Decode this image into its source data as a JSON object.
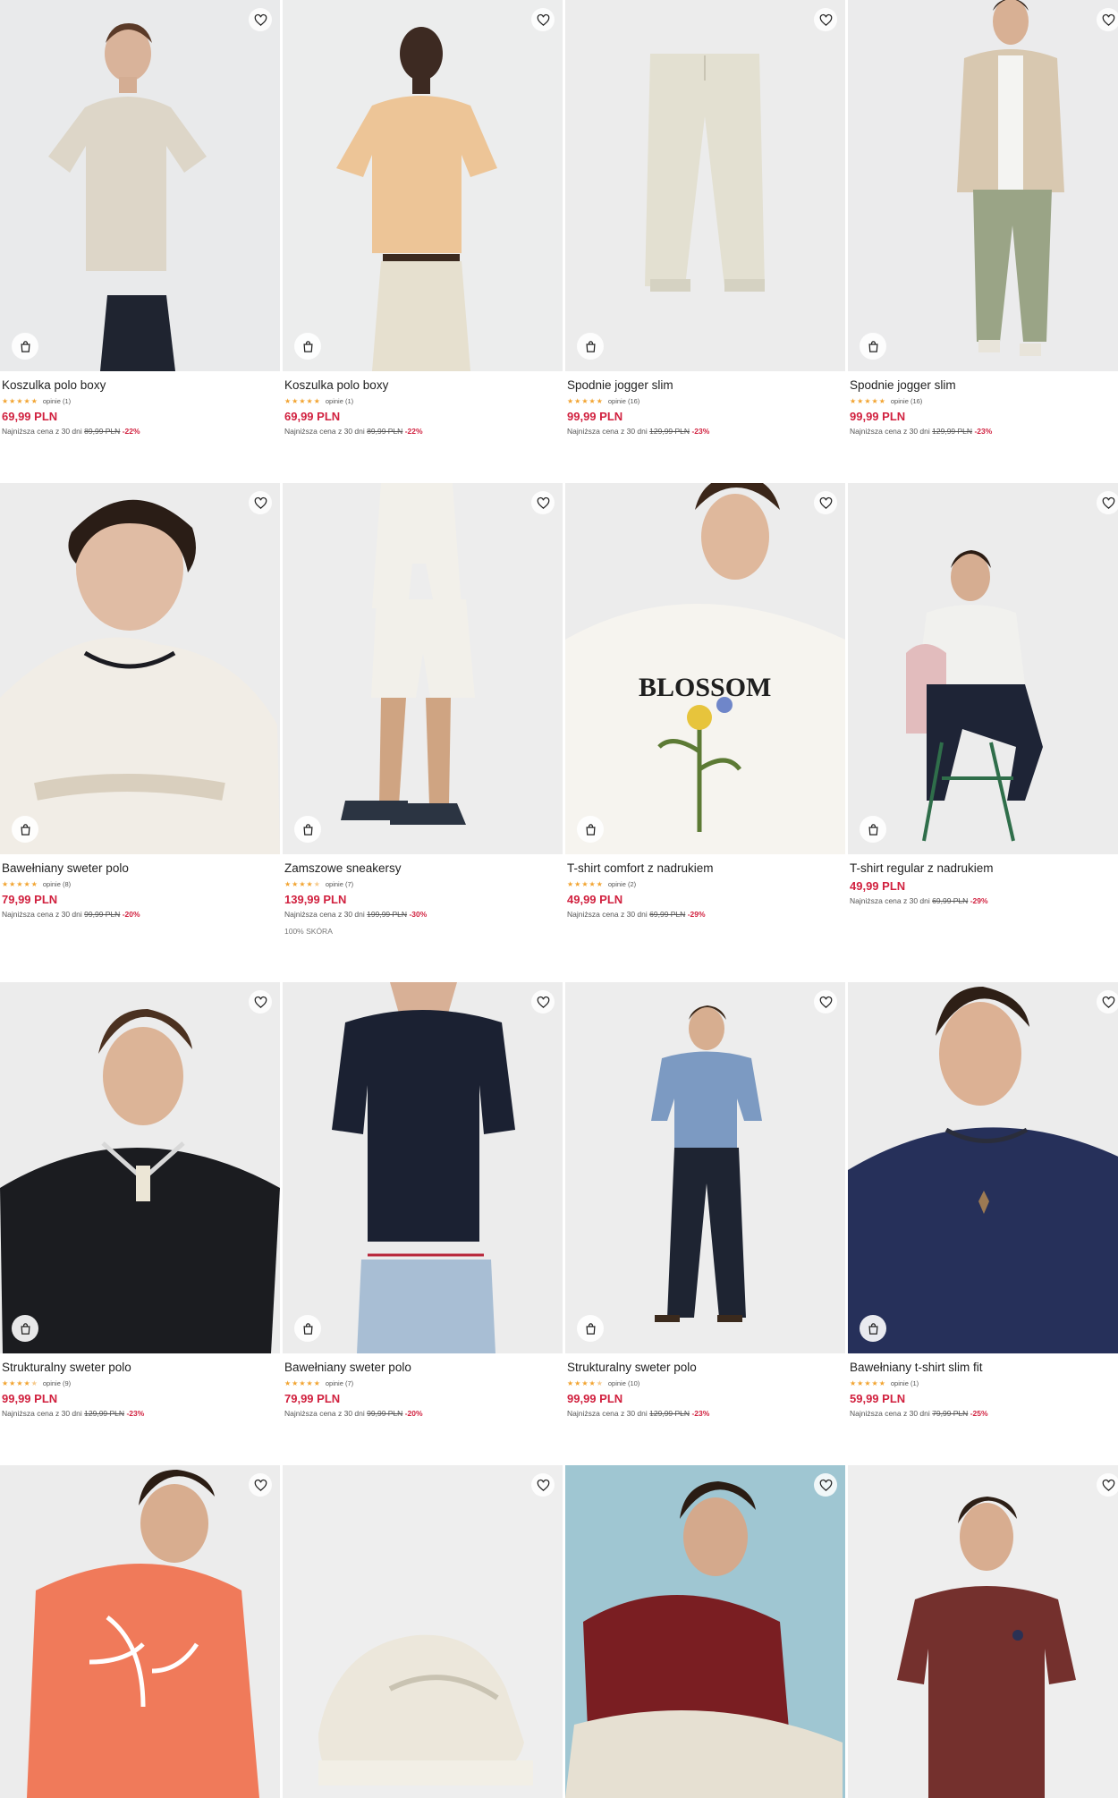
{
  "labels": {
    "lowest_prefix": "Najniższa cena z 30 dni",
    "reviews_prefix": "opinie"
  },
  "colors": {
    "price": "#d1213f",
    "star": "#f2a431",
    "image_bg": "#eceded"
  },
  "products": [
    {
      "name": "Koszulka polo boxy",
      "rating": 5,
      "reviews": "opinie (1)",
      "price": "69,99 PLN",
      "old_price": "89,99 PLN",
      "discount": "-22%",
      "icon": "heart-icon"
    },
    {
      "name": "Koszulka polo boxy",
      "rating": 5,
      "reviews": "opinie (1)",
      "price": "69,99 PLN",
      "old_price": "89,99 PLN",
      "discount": "-22%",
      "icon": "heart-icon"
    },
    {
      "name": "Spodnie jogger slim",
      "rating": 5,
      "reviews": "opinie (16)",
      "price": "99,99 PLN",
      "old_price": "129,99 PLN",
      "discount": "-23%",
      "icon": "heart-icon"
    },
    {
      "name": "Spodnie jogger slim",
      "rating": 5,
      "reviews": "opinie (16)",
      "price": "99,99 PLN",
      "old_price": "129,99 PLN",
      "discount": "-23%",
      "icon": "heart-icon"
    },
    {
      "name": "Bawełniany sweter polo",
      "rating": 5,
      "reviews": "opinie (8)",
      "price": "79,99 PLN",
      "old_price": "99,99 PLN",
      "discount": "-20%",
      "icon": "heart-icon"
    },
    {
      "name": "Zamszowe sneakersy",
      "rating": 4.5,
      "reviews": "opinie (7)",
      "price": "139,99 PLN",
      "old_price": "199,99 PLN",
      "discount": "-30%",
      "tag": "100% SKÓRA",
      "icon": "heart-icon"
    },
    {
      "name": "T-shirt comfort z nadrukiem",
      "rating": 5,
      "reviews": "opinie (2)",
      "price": "49,99 PLN",
      "old_price": "69,99 PLN",
      "discount": "-29%",
      "print_text": "BLOSSOM",
      "icon": "heart-icon"
    },
    {
      "name": "T-shirt regular z nadrukiem",
      "rating": 0,
      "reviews": "",
      "price": "49,99 PLN",
      "old_price": "69,99 PLN",
      "discount": "-29%",
      "icon": "heart-icon"
    },
    {
      "name": "Strukturalny sweter polo",
      "rating": 4.5,
      "reviews": "opinie (9)",
      "price": "99,99 PLN",
      "old_price": "129,99 PLN",
      "discount": "-23%",
      "icon": "heart-icon"
    },
    {
      "name": "Bawełniany sweter polo",
      "rating": 5,
      "reviews": "opinie (7)",
      "price": "79,99 PLN",
      "old_price": "99,99 PLN",
      "discount": "-20%",
      "icon": "heart-icon"
    },
    {
      "name": "Strukturalny sweter polo",
      "rating": 4.5,
      "reviews": "opinie (10)",
      "price": "99,99 PLN",
      "old_price": "129,99 PLN",
      "discount": "-23%",
      "icon": "heart-icon"
    },
    {
      "name": "Bawełniany t-shirt slim fit",
      "rating": 5,
      "reviews": "opinie (1)",
      "price": "59,99 PLN",
      "old_price": "79,99 PLN",
      "discount": "-25%",
      "icon": "heart-icon"
    },
    {
      "name": "",
      "icon": "heart-icon"
    },
    {
      "name": "",
      "icon": "heart-icon"
    },
    {
      "name": "",
      "icon": "heart-icon"
    },
    {
      "name": "",
      "icon": "heart-icon"
    }
  ]
}
